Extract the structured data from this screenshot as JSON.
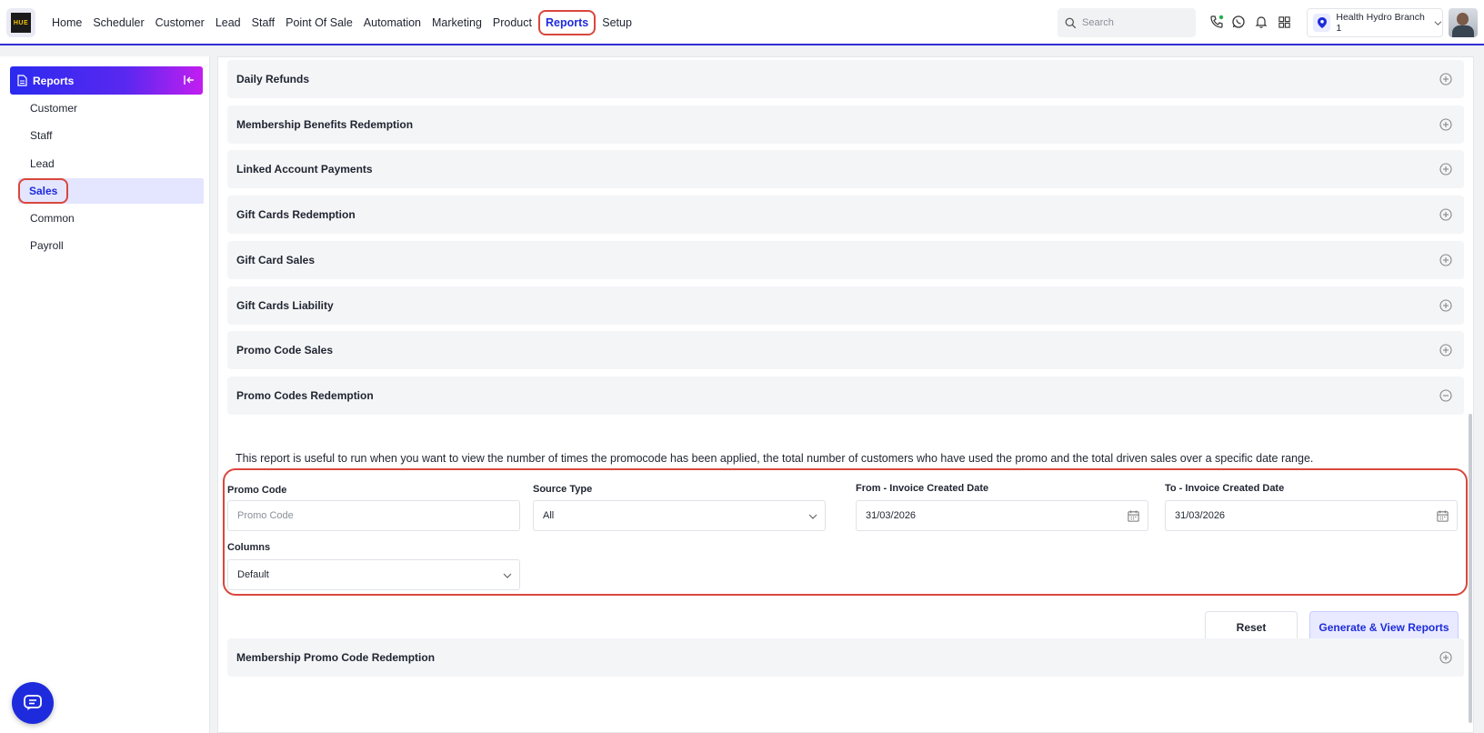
{
  "app": {
    "logo_text": "HUE"
  },
  "nav": {
    "items": [
      {
        "label": "Home",
        "active": false
      },
      {
        "label": "Scheduler",
        "active": false
      },
      {
        "label": "Customer",
        "active": false
      },
      {
        "label": "Lead",
        "active": false
      },
      {
        "label": "Staff",
        "active": false
      },
      {
        "label": "Point Of Sale",
        "active": false
      },
      {
        "label": "Automation",
        "active": false
      },
      {
        "label": "Marketing",
        "active": false
      },
      {
        "label": "Product",
        "active": false
      },
      {
        "label": "Reports",
        "active": true
      },
      {
        "label": "Setup",
        "active": false
      }
    ]
  },
  "header": {
    "search_placeholder": "Search",
    "branch": "Health Hydro Branch 1",
    "icons": [
      "phone-icon",
      "whatsapp-icon",
      "bell-icon",
      "grid-icon"
    ]
  },
  "sidebar": {
    "title": "Reports",
    "items": [
      {
        "label": "Customer",
        "active": false
      },
      {
        "label": "Staff",
        "active": false
      },
      {
        "label": "Lead",
        "active": false
      },
      {
        "label": "Sales",
        "active": true
      },
      {
        "label": "Common",
        "active": false
      },
      {
        "label": "Payroll",
        "active": false
      }
    ]
  },
  "accordions": [
    {
      "title": "Daily Refunds",
      "expanded": false
    },
    {
      "title": "Membership Benefits Redemption",
      "expanded": false
    },
    {
      "title": "Linked Account Payments",
      "expanded": false
    },
    {
      "title": "Gift Cards Redemption",
      "expanded": false
    },
    {
      "title": "Gift Card Sales",
      "expanded": false
    },
    {
      "title": "Gift Cards Liability",
      "expanded": false
    },
    {
      "title": "Promo Code Sales",
      "expanded": false
    },
    {
      "title": "Promo Codes Redemption",
      "expanded": true
    },
    {
      "title": "Membership Promo Code Redemption",
      "expanded": false
    }
  ],
  "report": {
    "description": "This report is useful to run when you want to view the number of times the promocode has been applied, the total number of customers who have used the promo and the total driven sales over a specific date range.",
    "fields": {
      "promo_code": {
        "label": "Promo Code",
        "placeholder": "Promo Code",
        "value": ""
      },
      "source_type": {
        "label": "Source Type",
        "value": "All"
      },
      "from_date": {
        "label": "From - Invoice Created Date",
        "value": "31/03/2026"
      },
      "to_date": {
        "label": "To - Invoice Created Date",
        "value": "31/03/2026"
      },
      "columns": {
        "label": "Columns",
        "value": "Default"
      }
    },
    "buttons": {
      "reset": "Reset",
      "generate": "Generate & View Reports"
    }
  },
  "colors": {
    "accent": "#1e2bdc",
    "highlight": "#d9473c",
    "active_bg": "#e4e6ff"
  }
}
